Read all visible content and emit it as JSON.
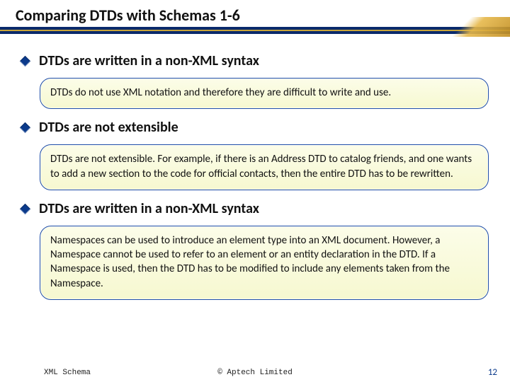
{
  "title": "Comparing DTDs with Schemas 1-6",
  "sections": [
    {
      "heading": "DTDs are written in a non-XML syntax",
      "body": "DTDs do not use XML notation and therefore they are difficult to write and use."
    },
    {
      "heading": "DTDs are not extensible",
      "body": "DTDs are not extensible. For example, if there is an Address DTD to catalog friends, and one wants to add a new section to the code for official contacts, then the entire DTD has to be rewritten."
    },
    {
      "heading": "DTDs are written in a non-XML syntax",
      "body": "Namespaces can be used to introduce an element type into an XML document. However, a Namespace cannot be used to refer to an element or an entity declaration in the DTD. If a Namespace is used, then the DTD has to be modified to include any elements taken from the Namespace."
    }
  ],
  "footer": {
    "left": "XML Schema",
    "center": "© Aptech Limited",
    "page": "12"
  }
}
